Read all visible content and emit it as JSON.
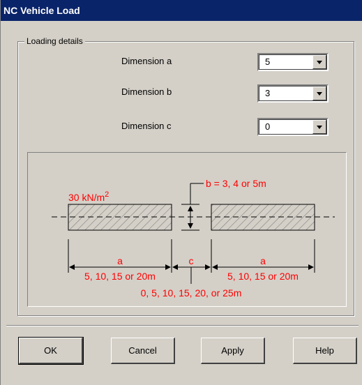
{
  "window": {
    "title": "NC Vehicle Load"
  },
  "group": {
    "label": "Loading details"
  },
  "fields": [
    {
      "label": "Dimension a",
      "value": "5"
    },
    {
      "label": "Dimension b",
      "value": "3"
    },
    {
      "label": "Dimension c",
      "value": "0"
    }
  ],
  "diagram": {
    "load": "30 kN/m",
    "load_exp": "2",
    "b_note": "b = 3, 4 or 5m",
    "a_label": "a",
    "a_range": "5, 10, 15 or 20m",
    "c_label": "c",
    "c_range": "0, 5, 10, 15, 20, or 25m"
  },
  "buttons": {
    "ok": "OK",
    "cancel": "Cancel",
    "apply": "Apply",
    "help": "Help"
  },
  "colors": {
    "titlebar": "#0a246a",
    "dialog": "#d4d0c8",
    "annotation": "#ff0000"
  }
}
